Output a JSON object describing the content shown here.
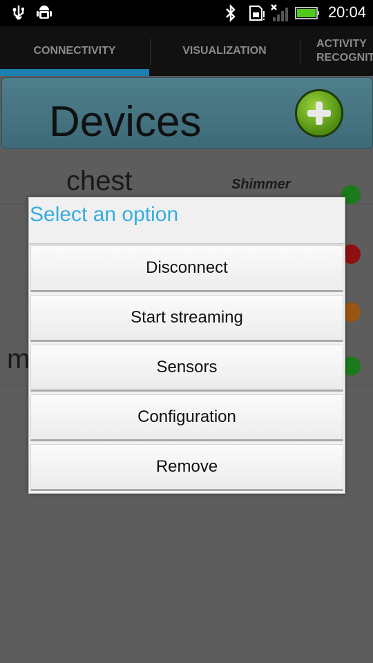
{
  "status_bar": {
    "time": "20:04",
    "icons": [
      "usb-icon",
      "android-debug-icon",
      "bluetooth-icon",
      "sd-card-icon",
      "signal-icon",
      "battery-icon"
    ]
  },
  "tabs": [
    {
      "label": "CONNECTIVITY",
      "selected": true
    },
    {
      "label": "VISUALIZATION",
      "selected": false
    },
    {
      "label": "ACTIVITY\nRECOGNIT",
      "selected": false
    }
  ],
  "header": {
    "title": "Devices",
    "add_icon": "plus-icon"
  },
  "device_rows": [
    {
      "name": "chest",
      "type": "Shimmer",
      "status_color": "#1b9b1b"
    },
    {
      "name": "",
      "type": "",
      "status_color": "#b31313"
    },
    {
      "name": "",
      "type": "",
      "status_color": "#c36a10"
    },
    {
      "name": "m",
      "type": "",
      "status_color": "#1b9b1b"
    }
  ],
  "dialog": {
    "title": "Select an option",
    "options": [
      "Disconnect",
      "Start streaming",
      "Sensors",
      "Configuration",
      "Remove"
    ]
  },
  "colors": {
    "accent": "#35ace0",
    "tab_indicator": "#1b7fb0"
  }
}
